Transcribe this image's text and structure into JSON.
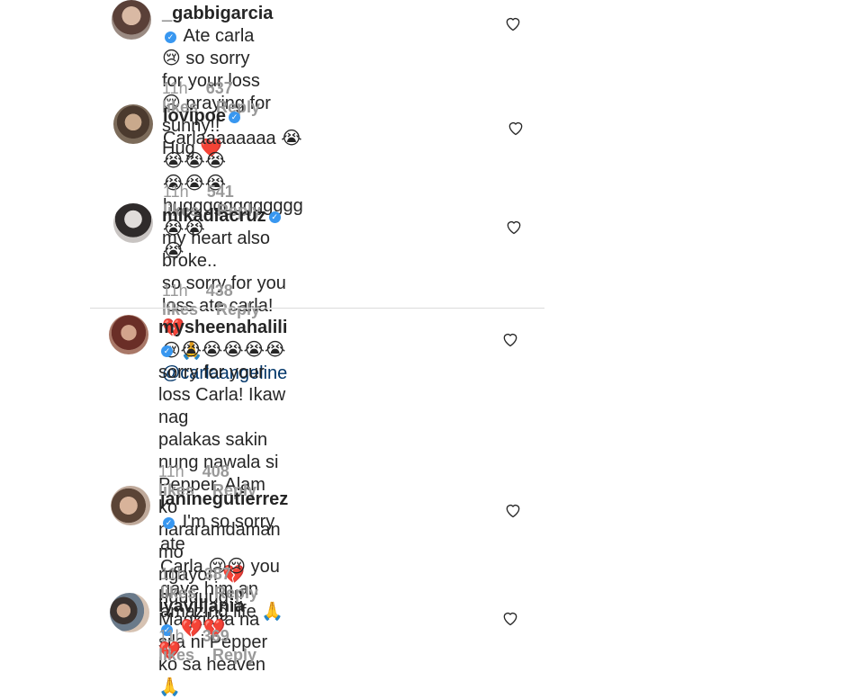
{
  "comments": [
    {
      "username": "_gabbigarcia",
      "lines": [
        "Ate carla 😢 so sorry",
        "for your loss 😢 praying for sunny!!",
        "Hug ❤️"
      ],
      "time": "11h",
      "likes": "637 likes",
      "reply": "Reply"
    },
    {
      "username": "lovipoe",
      "lines": [
        "Carlaaaaaaaa 😭😭😭😭",
        "😭😭😭 hugggggggggggg😭😭",
        "😭"
      ],
      "time": "11h",
      "likes": "541 likes",
      "reply": "Reply"
    },
    {
      "username": "mikadlacruz",
      "lines": [
        "my heart also broke..",
        "so sorry for you loss ate carla! 💔",
        "😢🙏"
      ],
      "mention": "@carlaangeline",
      "time": "11h",
      "likes": "438 likes",
      "reply": "Reply"
    },
    {
      "username": "mysheenahalili",
      "lines": [
        "😭😭😭😭😭",
        "sorry for your loss Carla! Ikaw nag",
        "palakas sakin nung nawala si",
        "Pepper. Alam ko nararamdaman mo",
        "ngayon 💔 huuuuug!!! Magkikita na",
        "sila ni Pepper ko sa heaven🙏"
      ],
      "time": "11h",
      "likes": "408 likes",
      "reply": "Reply"
    },
    {
      "username": "janinegutierrez",
      "lines": [
        "I'm so sorry ate",
        "Carla 😢😢 you gave him an",
        "amazing life 🙏"
      ],
      "time": "11h",
      "likes": "387 likes",
      "reply": "Reply"
    },
    {
      "username": "iyavillania",
      "lines": [
        "💔💔💔"
      ],
      "time": "11h",
      "likes": "369 likes",
      "reply": "Reply"
    }
  ],
  "colors": {
    "text": "#262626",
    "meta": "#999999",
    "verified": "#3897f0",
    "mention": "#003569"
  },
  "icons": {
    "verified": "verified-badge-icon",
    "like": "heart-outline-icon"
  }
}
